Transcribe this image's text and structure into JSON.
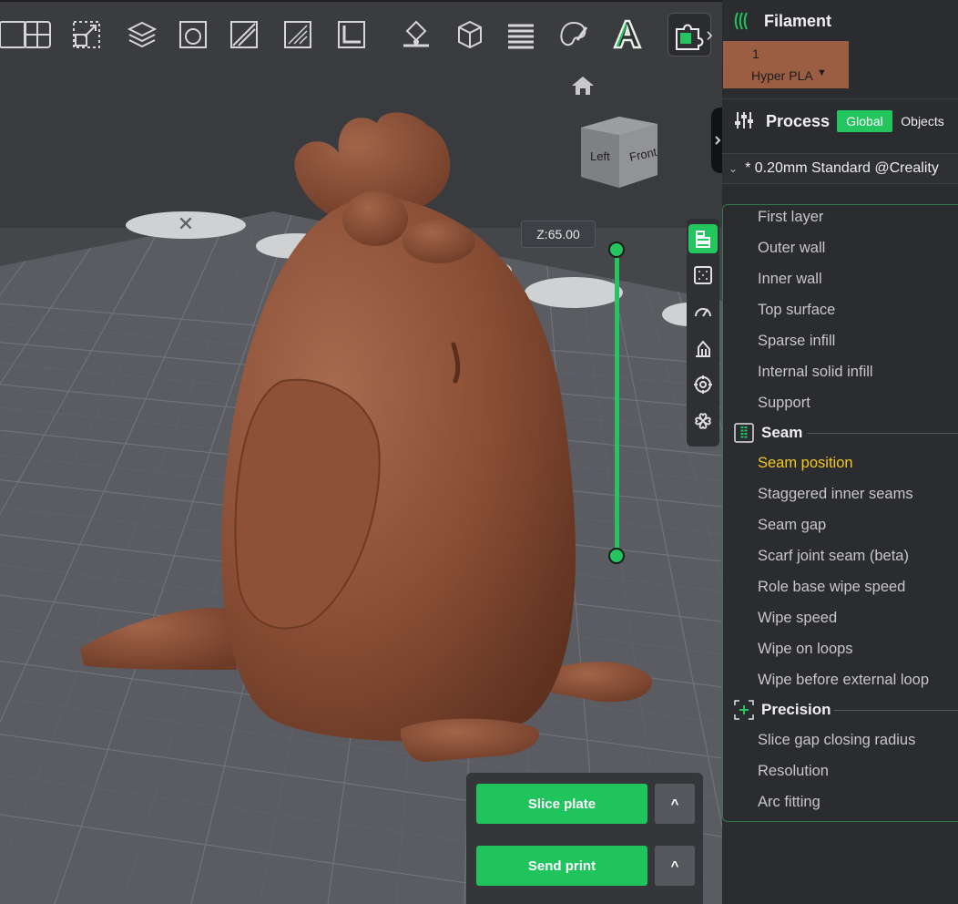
{
  "viewport": {
    "z_label": "Z:65.00",
    "view_cube": {
      "left": "Left",
      "front": "Front"
    },
    "buttons": {
      "slice": "Slice plate",
      "send": "Send print",
      "caret": "^"
    }
  },
  "toolbar": {
    "icons": [
      "arrange-icon",
      "split-icon",
      "scale-icon",
      "layers-icon",
      "cut-icon",
      "hollow-icon",
      "support-paint-icon",
      "measure-icon",
      "brim-ears-icon",
      "assembly-icon",
      "variable-layer-icon",
      "color-paint-icon",
      "text-icon",
      "puzzle-icon"
    ],
    "more": "›"
  },
  "filament": {
    "title": "Filament",
    "slot_number": "1",
    "material": "Hyper PLA",
    "color": "#9c5e43"
  },
  "process": {
    "title": "Process",
    "tab_global": "Global",
    "tab_objects": "Objects",
    "preset": "* 0.20mm Standard @Creality"
  },
  "settings": {
    "items_top": [
      "First layer",
      "Outer wall",
      "Inner wall",
      "Top surface",
      "Sparse infill",
      "Internal solid infill",
      "Support"
    ],
    "seam_group": "Seam",
    "seam_items": [
      "Seam position",
      "Staggered inner seams",
      "Seam gap",
      "Scarf joint seam (beta)",
      "Role base wipe speed",
      "Wipe speed",
      "Wipe on loops",
      "Wipe before external loop"
    ],
    "precision_group": "Precision",
    "precision_items": [
      "Slice gap closing radius",
      "Resolution",
      "Arc fitting"
    ]
  },
  "colors": {
    "accent": "#22c55e",
    "active_item": "#f2c81e",
    "model": "#8a4e35"
  }
}
